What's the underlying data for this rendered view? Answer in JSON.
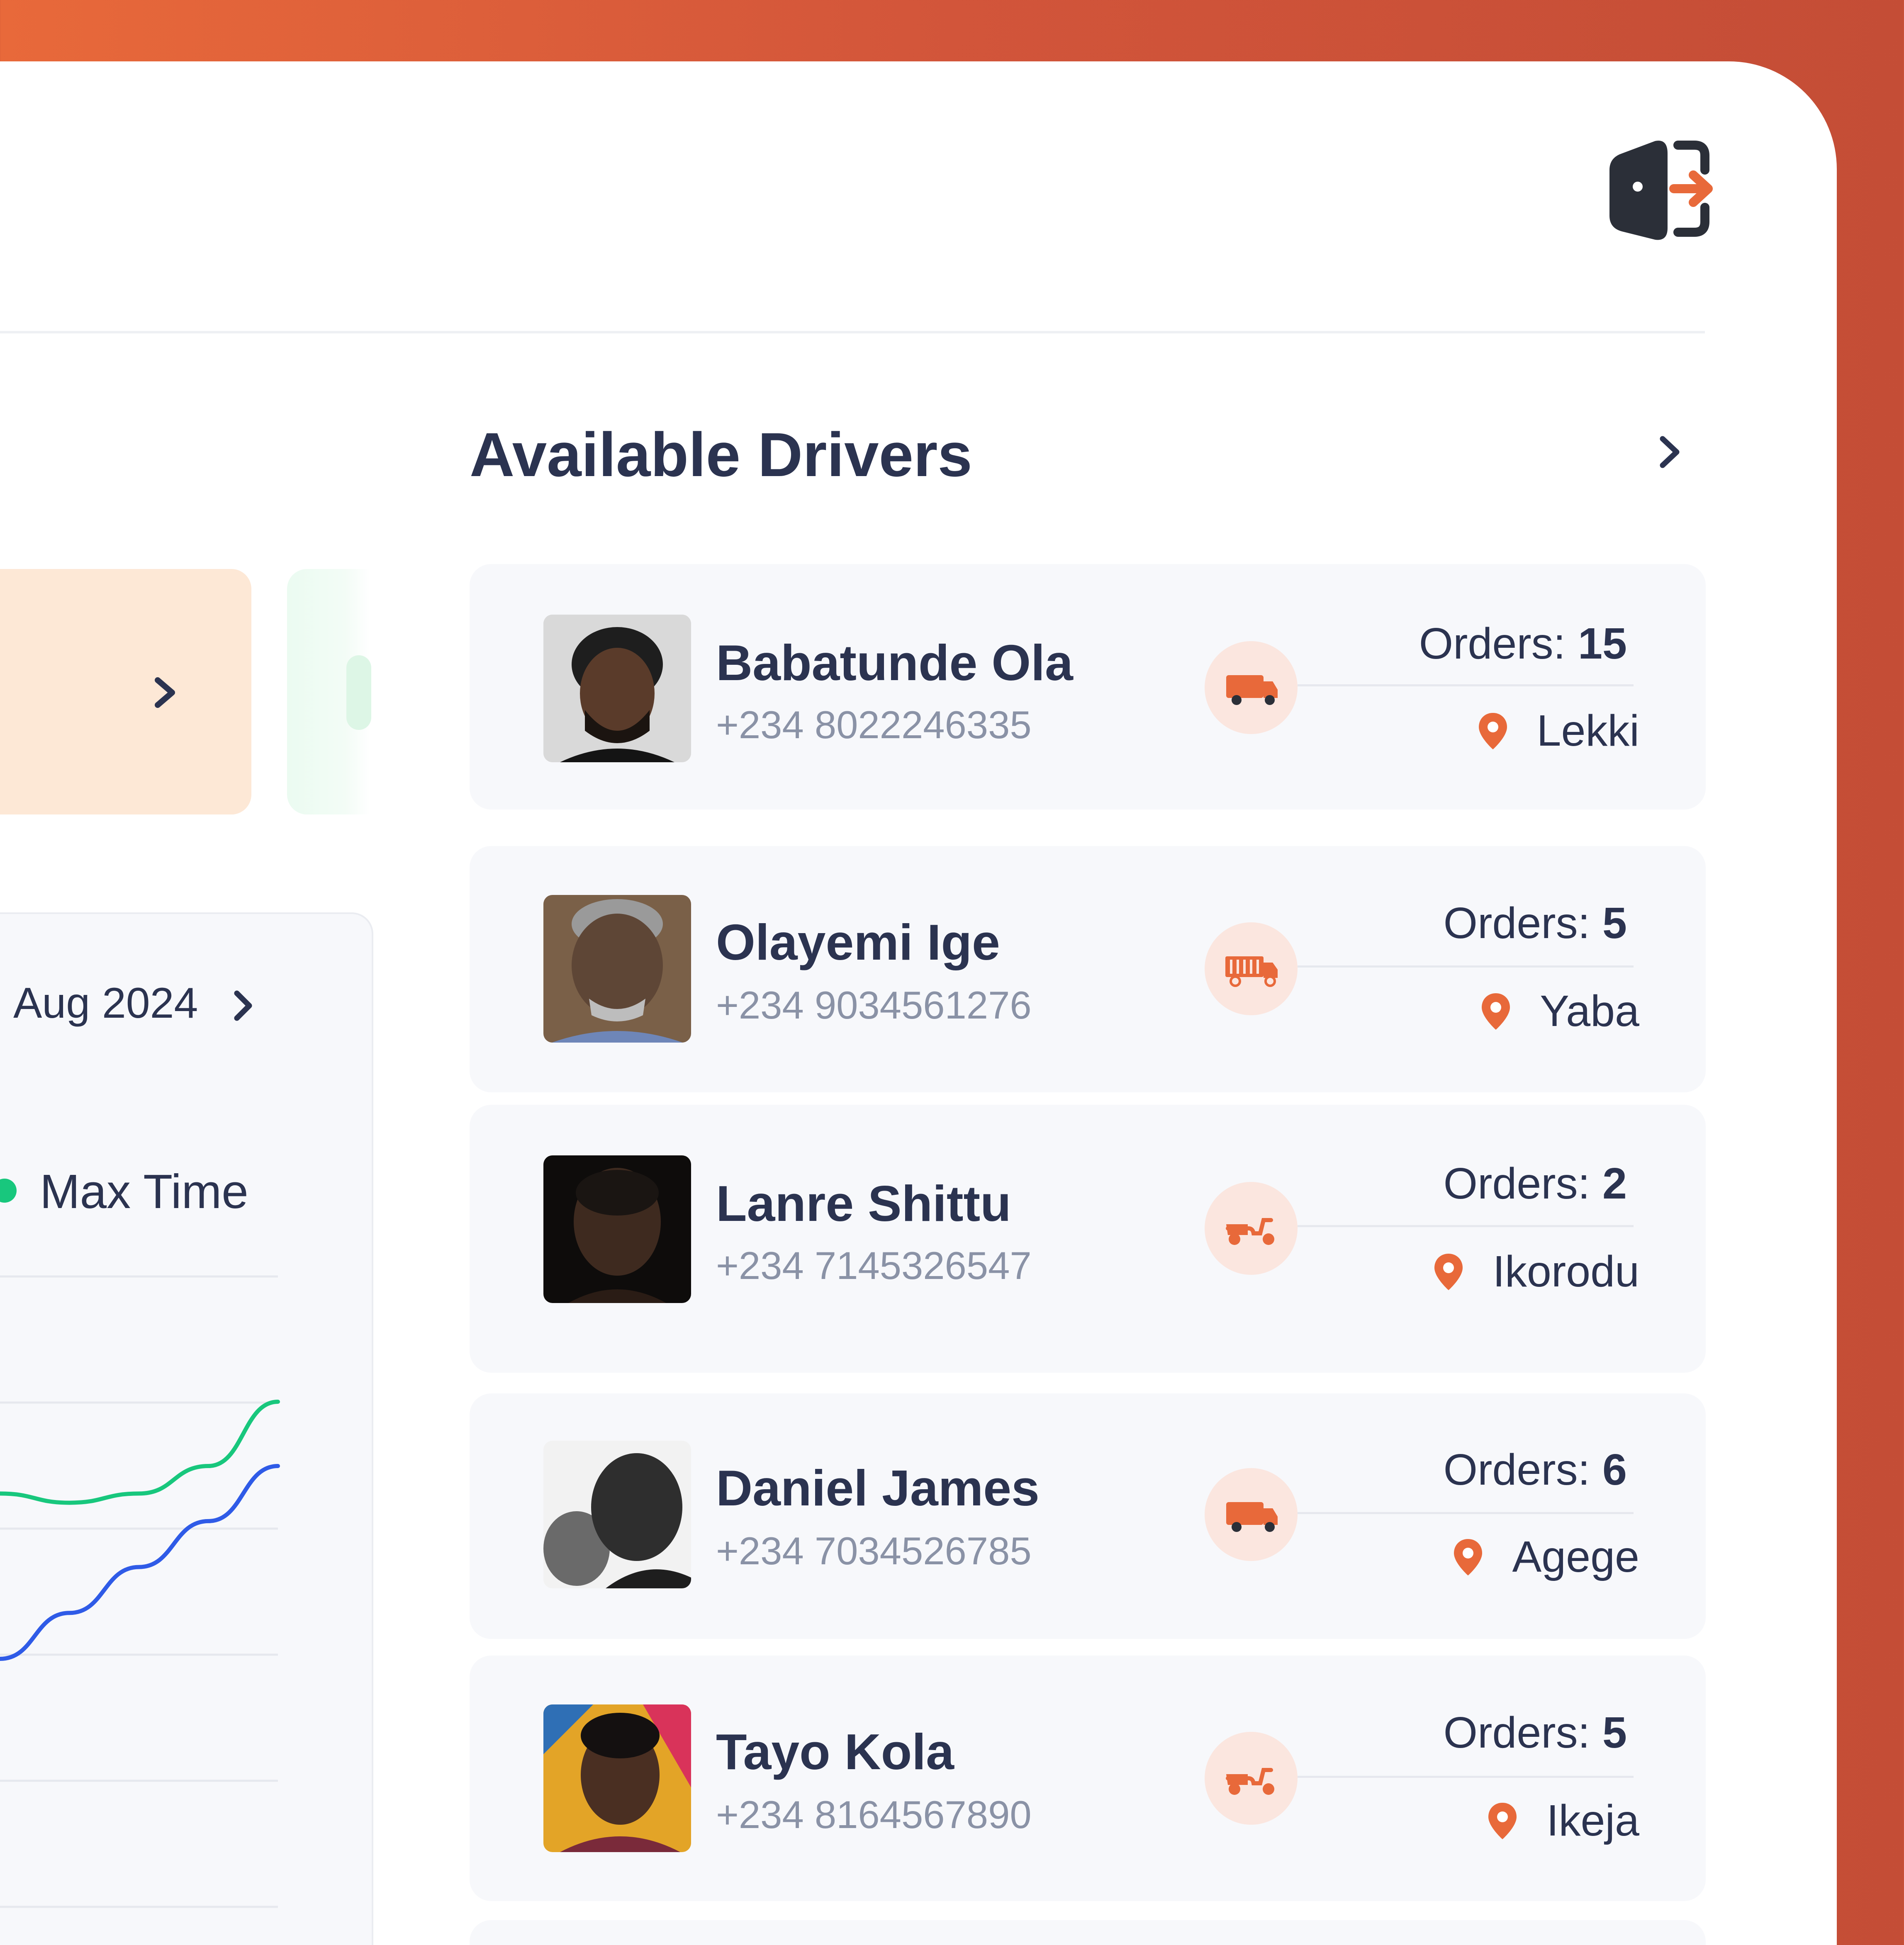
{
  "header": {
    "logout_icon": "logout-door-icon"
  },
  "chart_panel": {
    "month_label": "Aug 2024",
    "legend": [
      {
        "label": "Max Time",
        "color": "#18C77D"
      }
    ]
  },
  "chart_data": {
    "type": "line",
    "title": "",
    "series": [
      {
        "name": "Max Time",
        "color": "#18C77D",
        "values": [
          0.36,
          0.34,
          0.36,
          0.42,
          0.56
        ]
      },
      {
        "name": "",
        "color": "#2F5BE7",
        "values": [
          0.0,
          0.1,
          0.2,
          0.3,
          0.42
        ]
      }
    ],
    "x": [
      0,
      1,
      2,
      3,
      4
    ],
    "grid": true
  },
  "drivers": {
    "title": "Available Drivers",
    "orders_label": "Orders:",
    "items": [
      {
        "name": "Babatunde Ola",
        "phone": "+234 8022246335",
        "orders": "15",
        "location": "Lekki",
        "vehicle": "truck-icon"
      },
      {
        "name": "Olayemi Ige",
        "phone": "+234 9034561276",
        "orders": "5",
        "location": "Yaba",
        "vehicle": "lorry-icon"
      },
      {
        "name": "Lanre Shittu",
        "phone": "+234 7145326547",
        "orders": "2",
        "location": "Ikorodu",
        "vehicle": "scooter-icon"
      },
      {
        "name": "Daniel James",
        "phone": "+234 7034526785",
        "orders": "6",
        "location": "Agege",
        "vehicle": "truck-icon"
      },
      {
        "name": "Tayo Kola",
        "phone": "+234 8164567890",
        "orders": "5",
        "location": "Ikeja",
        "vehicle": "scooter-icon"
      }
    ]
  },
  "colors": {
    "accent": "#E8693A",
    "text_dark": "#2B3350",
    "text_muted": "#8A92A6",
    "card_bg": "#F7F8FB"
  }
}
